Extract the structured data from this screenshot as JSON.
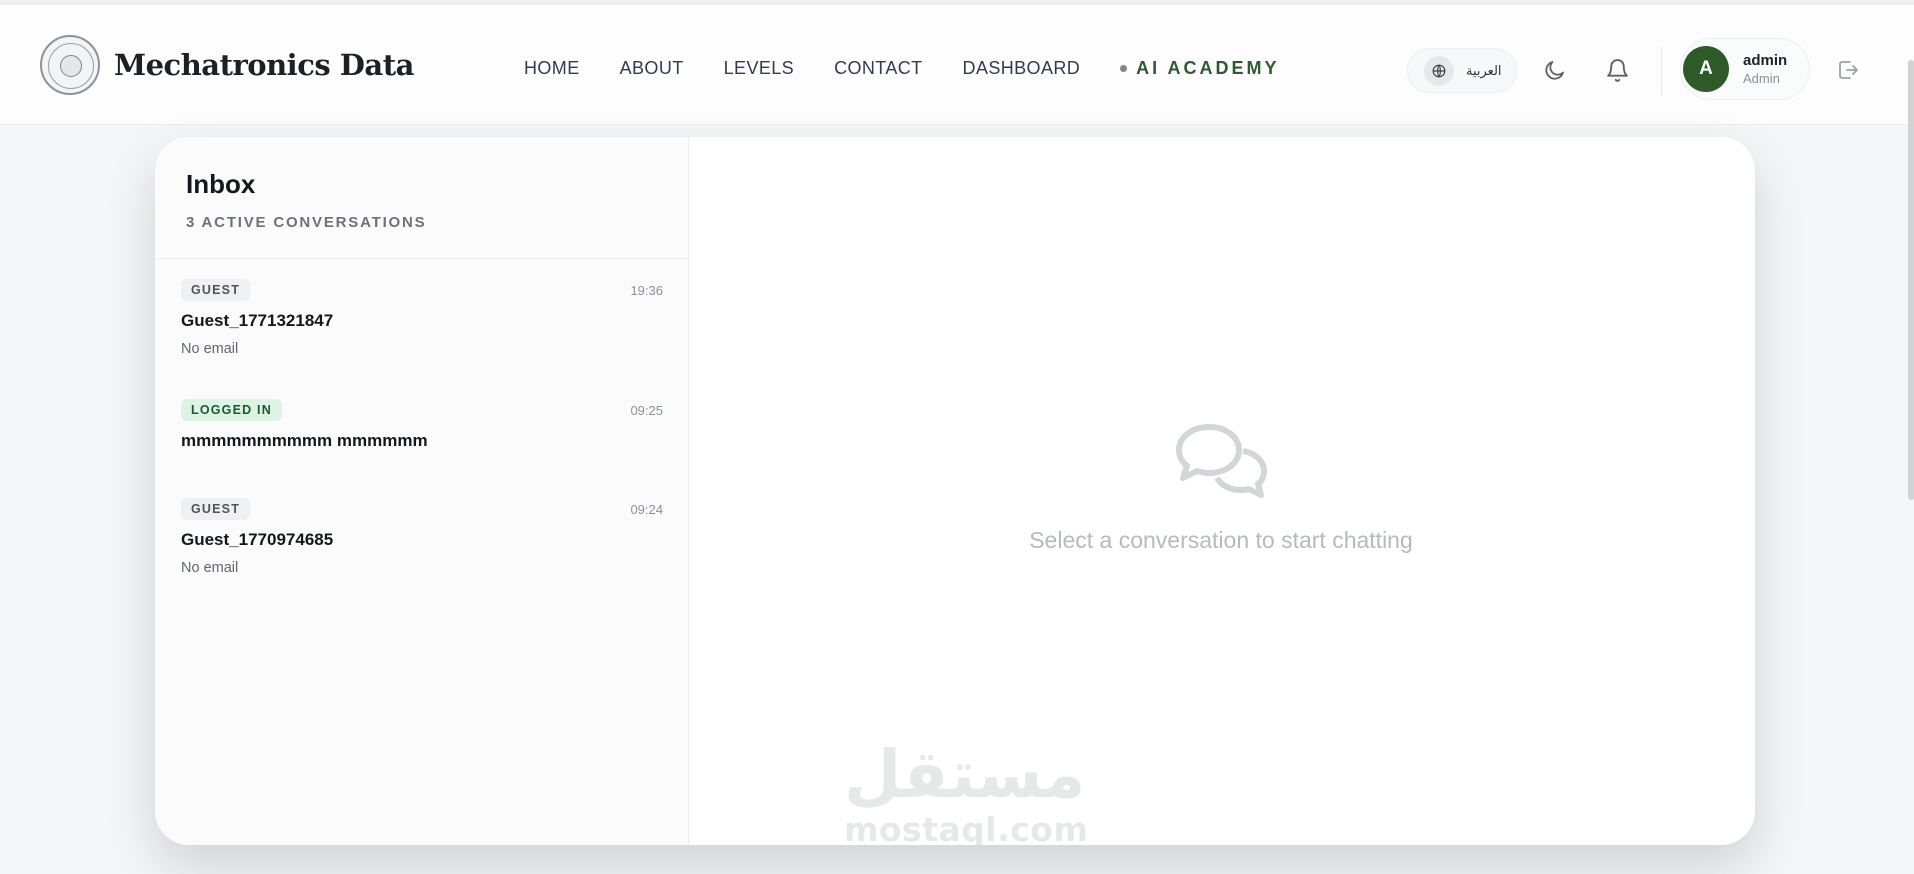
{
  "brand": {
    "name": "Mechatronics Data",
    "logo_icon": "faculty-seal-logo"
  },
  "nav": {
    "items": [
      {
        "label": "HOME"
      },
      {
        "label": "ABOUT"
      },
      {
        "label": "LEVELS"
      },
      {
        "label": "CONTACT"
      },
      {
        "label": "DASHBOARD"
      }
    ],
    "academy_label": "AI ACADEMY"
  },
  "header_actions": {
    "language_label": "العربية",
    "theme_icon": "moon-icon",
    "notifications_icon": "bell-icon",
    "logout_icon": "logout-icon"
  },
  "user": {
    "initial": "A",
    "name": "admin",
    "role": "Admin"
  },
  "inbox": {
    "title": "Inbox",
    "subtitle": "3 ACTIVE CONVERSATIONS",
    "conversations": [
      {
        "badge": "GUEST",
        "time": "19:36",
        "name": "Guest_1771321847",
        "email": "No email"
      },
      {
        "badge": "LOGGED IN",
        "time": "09:25",
        "name": "mmmmmmmmmm mmmmmm",
        "email": ""
      },
      {
        "badge": "GUEST",
        "time": "09:24",
        "name": "Guest_1770974685",
        "email": "No email"
      }
    ]
  },
  "chat": {
    "empty_icon": "chat-bubbles-icon",
    "empty_text": "Select a conversation to start chatting"
  },
  "watermark": {
    "arabic": "مستقل",
    "latin": "mostaql.com"
  },
  "colors": {
    "brand_green": "#2d5a27",
    "badge_logged_bg": "#ddf3e4",
    "nav_text": "#2f3d52"
  }
}
